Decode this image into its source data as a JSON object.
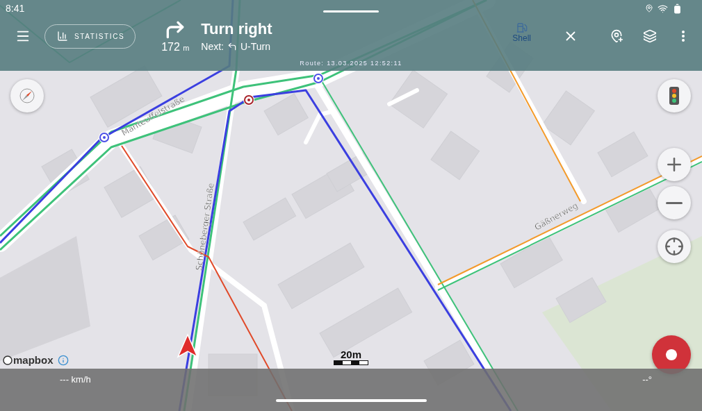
{
  "status_bar": {
    "time": "8:41"
  },
  "top_bar": {
    "statistics_button": "STATISTICS",
    "distance": "172",
    "distance_unit": "m",
    "instruction": "Turn right",
    "next_label": "Next:",
    "next_instruction": "U-Turn",
    "poi_label": "Shell",
    "route_label": "Route: 13.03.2025 12:52:11"
  },
  "map": {
    "street_labels": [
      {
        "text": "Manteuffelstraße"
      },
      {
        "text": "Schöneberger Straße"
      },
      {
        "text": "Gäßnerweg"
      }
    ],
    "attribution": "mapbox",
    "scale": "20m"
  },
  "record_button": {
    "recording": false
  },
  "bottom_bar": {
    "speed": "--- km/h",
    "heading": "--°"
  }
}
